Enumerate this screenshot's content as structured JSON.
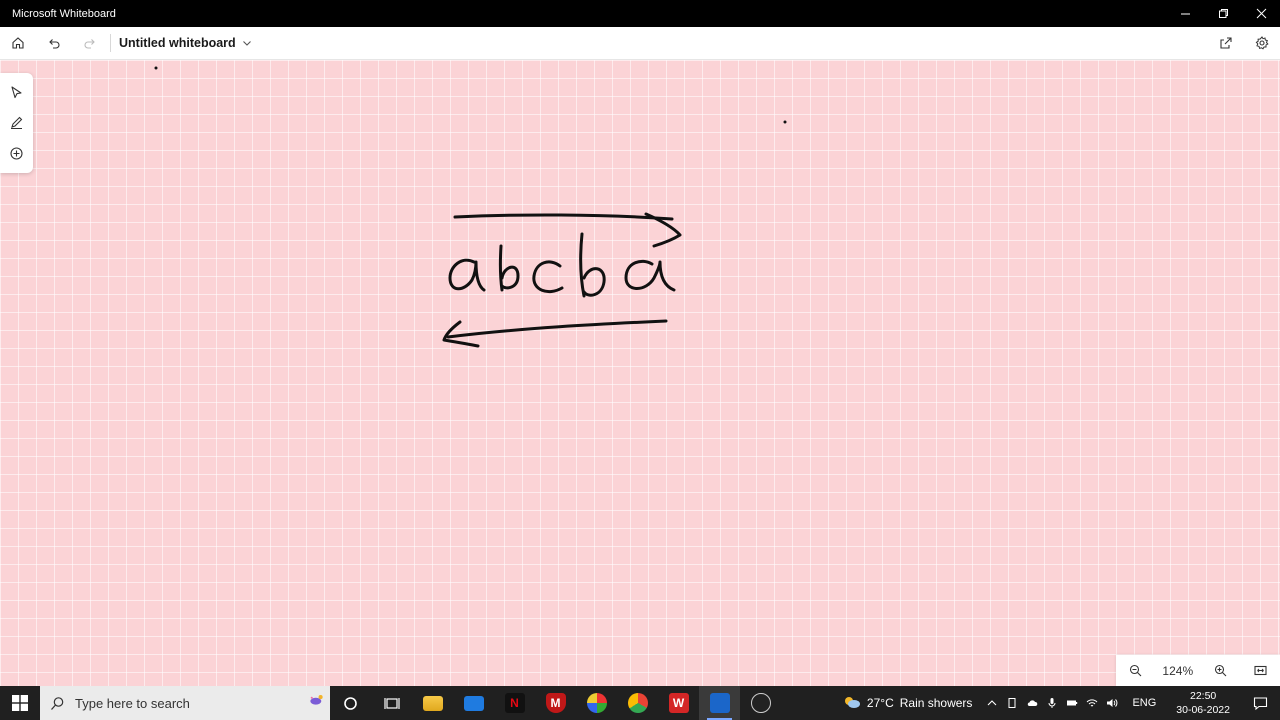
{
  "window": {
    "title": "Microsoft Whiteboard",
    "minimize_icon": "minimize-icon",
    "maximize_icon": "maximize-icon",
    "close_icon": "close-icon"
  },
  "toolbar": {
    "home_icon": "home-icon",
    "undo_icon": "undo-icon",
    "redo_icon": "redo-icon",
    "board_title": "Untitled whiteboard",
    "share_icon": "share-icon",
    "settings_icon": "gear-icon"
  },
  "side_tools": {
    "items": [
      "select-icon",
      "pen-icon",
      "add-icon"
    ]
  },
  "canvas": {
    "background": "#fbd3d6",
    "ink_color": "#111111",
    "handwritten_text": "abcba"
  },
  "zoom": {
    "level": "124%"
  },
  "taskbar": {
    "search_placeholder": "Type here to search",
    "apps": [
      "cortana-icon",
      "task-view-icon",
      "file-explorer-icon",
      "mail-icon",
      "netflix-icon",
      "mcafee-icon",
      "app-icon",
      "chrome-icon",
      "wps-icon",
      "whiteboard-icon",
      "screen-recorder-icon"
    ],
    "weather_temp": "27°C",
    "weather_text": "Rain showers",
    "language": "ENG",
    "time": "22:50",
    "date": "30-06-2022"
  }
}
